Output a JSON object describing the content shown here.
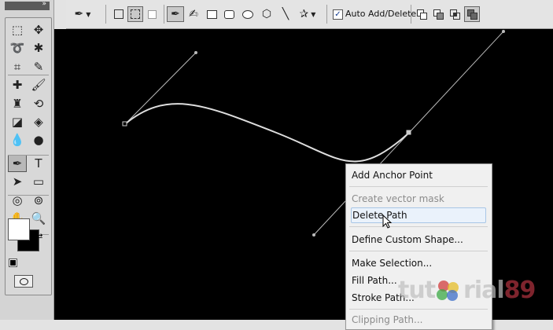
{
  "options_bar": {
    "auto_add_delete_label": "Auto Add/Delete",
    "auto_add_delete_checked": true
  },
  "toolbox": {
    "tools": [
      {
        "name": "marquee-tool-icon",
        "glyph": "⬚"
      },
      {
        "name": "move-tool-icon",
        "glyph": "✥"
      },
      {
        "name": "lasso-tool-icon",
        "glyph": "➰"
      },
      {
        "name": "magic-wand-tool-icon",
        "glyph": "✱"
      },
      {
        "name": "crop-tool-icon",
        "glyph": "⌗"
      },
      {
        "name": "eyedropper-tool-icon",
        "glyph": "✎"
      },
      {
        "name": "healing-brush-tool-icon",
        "glyph": "✚"
      },
      {
        "name": "brush-tool-icon",
        "glyph": "🖌"
      },
      {
        "name": "clone-stamp-tool-icon",
        "glyph": "♜"
      },
      {
        "name": "history-brush-tool-icon",
        "glyph": "⟲"
      },
      {
        "name": "eraser-tool-icon",
        "glyph": "◪"
      },
      {
        "name": "paint-bucket-tool-icon",
        "glyph": "◈"
      },
      {
        "name": "blur-tool-icon",
        "glyph": "💧"
      },
      {
        "name": "dodge-tool-icon",
        "glyph": "●"
      },
      {
        "name": "pen-tool-icon",
        "glyph": "✒",
        "active": true
      },
      {
        "name": "type-tool-icon",
        "glyph": "T"
      },
      {
        "name": "path-selection-tool-icon",
        "glyph": "➤"
      },
      {
        "name": "rectangle-tool-icon",
        "glyph": "▭"
      },
      {
        "name": "3d-rotate-tool-icon",
        "glyph": "◎"
      },
      {
        "name": "3d-orbit-tool-icon",
        "glyph": "⊚"
      },
      {
        "name": "hand-tool-icon",
        "glyph": "✋"
      },
      {
        "name": "zoom-tool-icon",
        "glyph": "🔍"
      }
    ]
  },
  "context_menu": {
    "items": [
      {
        "label": "Add Anchor Point",
        "state": "normal"
      },
      {
        "label": "Create vector mask",
        "state": "disabled"
      },
      {
        "label": "Delete Path",
        "state": "hover"
      },
      {
        "label": "Define Custom Shape...",
        "state": "normal"
      },
      {
        "label": "Make Selection...",
        "state": "normal"
      },
      {
        "label": "Fill Path...",
        "state": "normal"
      },
      {
        "label": "Stroke Path...",
        "state": "normal"
      },
      {
        "label": "Clipping Path...",
        "state": "disabled"
      }
    ]
  },
  "watermark": {
    "text_a": "tut",
    "text_b": "rial",
    "text_c": "89"
  },
  "colors": {
    "canvas": "#000000",
    "foreground": "#ffffff",
    "background": "#000000",
    "path": "#cfcfcf"
  }
}
